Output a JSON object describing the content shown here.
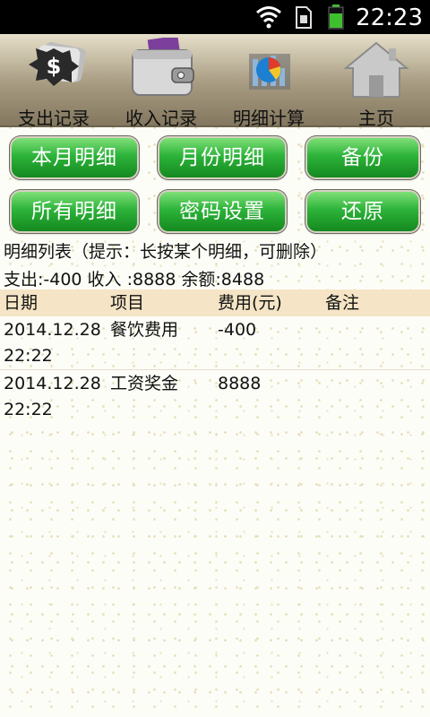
{
  "status_bar": {
    "time": "22:23"
  },
  "tabs": [
    {
      "label": "支出记录",
      "icon": "expense-money-icon",
      "active": false
    },
    {
      "label": "收入记录",
      "icon": "wallet-icon",
      "active": false
    },
    {
      "label": "明细计算",
      "icon": "pie-chart-icon",
      "active": true
    },
    {
      "label": "主页",
      "icon": "home-icon",
      "active": false
    }
  ],
  "buttons": {
    "month_detail": "本月明细",
    "monthly_detail": "月份明细",
    "backup": "备份",
    "all_detail": "所有明细",
    "password_settings": "密码设置",
    "restore": "还原"
  },
  "hint": "明细列表（提示：长按某个明细，可删除）",
  "summary": "支出:-400 收入 :8888 余额:8488",
  "table": {
    "headers": {
      "date": "日期",
      "item": "项目",
      "amount": "费用(元)",
      "note": "备注"
    },
    "rows": [
      {
        "date": "2014.12.28 22:22",
        "item": "餐饮费用",
        "amount": "-400",
        "note": ""
      },
      {
        "date": "2014.12.28 22:22",
        "item": "工资奖金",
        "amount": "8888",
        "note": ""
      }
    ]
  },
  "colors": {
    "button_green": "#2db33a",
    "tab_bar": "#a69a80",
    "table_header": "#f5e5c6"
  }
}
